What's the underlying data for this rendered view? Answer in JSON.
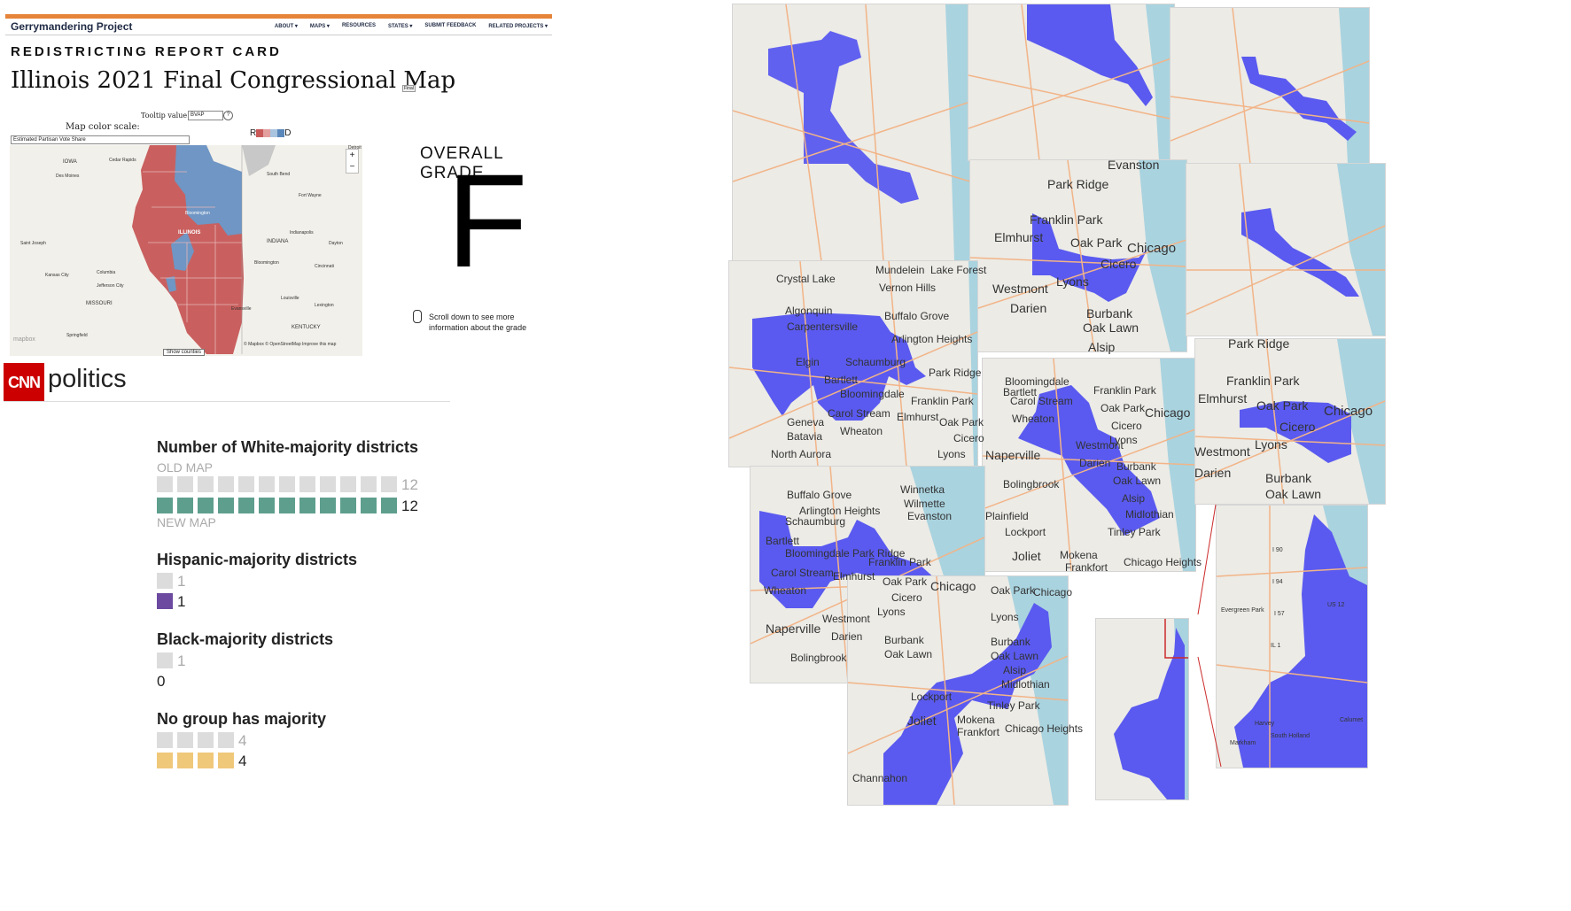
{
  "gp": {
    "site_title": "Gerrymandering Project",
    "nav": [
      "ABOUT ▾",
      "MAPS ▾",
      "RESOURCES",
      "STATES ▾",
      "SUBMIT FEEDBACK",
      "RELATED PROJECTS ▾"
    ],
    "kicker": "REDISTRICTING REPORT CARD",
    "title": "Illinois 2021 Final Congressional Map",
    "badge": "Final",
    "tooltip_label": "Tooltip value:",
    "tooltip_value": "BVAP",
    "help": "?",
    "color_scale_label": "Map color scale:",
    "color_scale_value": "Estimated Partisan Vote Share",
    "legend_r": "R",
    "legend_d": "D",
    "legend_colors": [
      "#c95a5a",
      "#e39e9e",
      "#a9c4df",
      "#5b88bb"
    ],
    "map_labels": [
      "IOWA",
      "Cedar Rapids",
      "Des Moines",
      "ILLINOIS",
      "INDIANA",
      "MISSOURI",
      "KENTUCKY",
      "Kansas City",
      "Columbia",
      "Jefferson City",
      "Springfield",
      "Saint Joseph",
      "South Bend",
      "Fort Wayne",
      "Indianapolis",
      "Bloomington",
      "Cincinnati",
      "Louisville",
      "Lexington",
      "Dayton",
      "Evansville",
      "Detroit",
      "Bloomington"
    ],
    "attribution": "© Mapbox © OpenStreetMap  Improve this map",
    "mapbox": "mapbox",
    "zoom_in": "+",
    "zoom_out": "−",
    "show_counties": "Show counties",
    "grade_label": "OVERALL GRADE",
    "grade": "F",
    "scroll_note": "Scroll down to see more information about the grade"
  },
  "cnn": {
    "logo": "CNN",
    "word": "politics"
  },
  "stats": {
    "white": {
      "title": "Number of White-majority districts",
      "old_label": "OLD MAP",
      "new_label": "NEW MAP",
      "old": 12,
      "new": 12,
      "color": "#5e9e8d"
    },
    "hispanic": {
      "title": "Hispanic-majority districts",
      "old": 1,
      "new": 1,
      "color": "#6b4aa0"
    },
    "black": {
      "title": "Black-majority districts",
      "old": 1,
      "new": 0,
      "color": "#6b4aa0"
    },
    "none": {
      "title": "No group has majority",
      "old": 4,
      "new": 4,
      "color": "#f0c87a"
    },
    "old_color": "#dcdcdc"
  },
  "collage": {
    "district_color": "#5a5af0",
    "water_color": "#a9d3df",
    "labels": {
      "t1": [
        "Crystal Lake",
        "Algonquin",
        "Carpentersville",
        "Elgin",
        "Schaumburg",
        "Bartlett",
        "Bloomingdale",
        "Carol Stream",
        "Wheaton",
        "Geneva",
        "Batavia",
        "North Aurora",
        "Mundelein",
        "Lake Forest",
        "Vernon Hills",
        "Buffalo Grove",
        "Arlington Heights",
        "Park Ridge",
        "Franklin Park",
        "Elmhurst",
        "Oak Park",
        "Cicero",
        "Lyons",
        "Winnetka",
        "Evanston",
        "Chicago"
      ],
      "t2": [
        "Park Ridge",
        "Franklin Park",
        "Elmhurst",
        "Oak Park",
        "Chicago",
        "Cicero",
        "Lyons",
        "Westmont",
        "Darien",
        "Burbank",
        "Oak Lawn",
        "Alsip",
        "Evanston",
        "Bloomingdale"
      ],
      "t3": [
        "Park Ridge",
        "Franklin Park",
        "Elmhurst",
        "Oak Park",
        "Chicago",
        "Cicero",
        "Lyons",
        "Westmont",
        "Darien",
        "Burbank",
        "Oak Lawn"
      ],
      "t4": [
        "Bartlett",
        "Bloomingdale",
        "Carol Stream",
        "Wheaton",
        "Naperville",
        "Bolingbrook",
        "Westmont",
        "Darien",
        "Franklin Park",
        "Oak Park",
        "Chicago",
        "Cicero",
        "Lyons",
        "Burbank",
        "Oak Lawn",
        "Alsip",
        "Midlothian",
        "Tinley Park",
        "Lockport",
        "Joliet",
        "Mokena",
        "Frankfort",
        "Chicago Heights",
        "Plainfield"
      ],
      "t5": [
        "Buffalo Grove",
        "Arlington Heights",
        "Schaumburg",
        "Bartlett",
        "Bloomingdale",
        "Carol Stream",
        "Wheaton",
        "Winnetka",
        "Wilmette",
        "Evanston",
        "Park Ridge",
        "Franklin Park",
        "Elmhurst",
        "Oak Park",
        "Chicago",
        "Cicero",
        "Lyons",
        "Westmont",
        "Naperville",
        "Darien",
        "Burbank",
        "Oak Lawn",
        "Bolingbrook"
      ],
      "t6": [
        "Oak Park",
        "Chicago",
        "Lyons",
        "Burbank",
        "Oak Lawn",
        "Alsip",
        "Midlothian",
        "Tinley Park",
        "Lockport",
        "Joliet",
        "Mokena",
        "Frankfort",
        "Chicago Heights",
        "Channahon"
      ],
      "t7": [
        "Evergreen Park",
        "Harvey",
        "South Holland",
        "Calumet",
        "Markham",
        "US 12",
        "I 57",
        "I 94",
        "I 90",
        "IL 1"
      ]
    }
  }
}
